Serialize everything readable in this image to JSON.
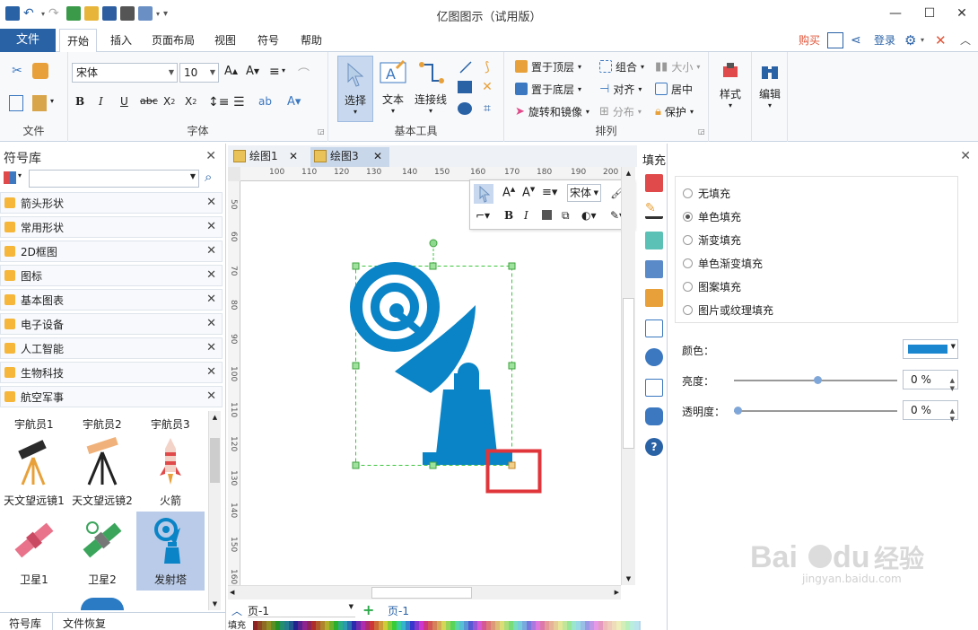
{
  "window": {
    "title": "亿图图示（试用版）",
    "controls": [
      "—",
      "☐",
      "✕"
    ]
  },
  "menu": {
    "file": "文件",
    "tabs": [
      "开始",
      "插入",
      "页面布局",
      "视图",
      "符号",
      "帮助"
    ],
    "active_tab": "开始",
    "right": {
      "buy": "购买",
      "login": "登录"
    }
  },
  "ribbon": {
    "groups": {
      "file": "文件",
      "font": "字体",
      "basic_tools": "基本工具",
      "arrange": "排列"
    },
    "font_name": "宋体",
    "font_size": "10",
    "select_label": "选择",
    "text_label": "文本",
    "connector_label": "连接线",
    "arrange": {
      "bring_front": "置于顶层",
      "send_back": "置于底层",
      "rotate_mirror": "旋转和镜像",
      "group": "组合",
      "align": "对齐",
      "distribute": "分布",
      "size": "大小",
      "center": "居中",
      "protect": "保护"
    },
    "style_label": "样式",
    "edit_label": "编辑"
  },
  "library": {
    "title": "符号库",
    "categories": [
      "箭头形状",
      "常用形状",
      "2D框图",
      "图标",
      "基本图表",
      "电子设备",
      "人工智能",
      "生物科技",
      "航空军事"
    ],
    "symbols_top_labels": [
      "宇航员1",
      "宇航员2",
      "宇航员3"
    ],
    "symbols": [
      {
        "label": "天文望远镜1"
      },
      {
        "label": "天文望远镜2"
      },
      {
        "label": "火箭"
      },
      {
        "label": "卫星1"
      },
      {
        "label": "卫星2"
      },
      {
        "label": "发射塔"
      }
    ],
    "bottom_tabs": [
      "符号库",
      "文件恢复"
    ]
  },
  "documents": {
    "tabs": [
      "绘图1",
      "绘图3"
    ],
    "active": "绘图3"
  },
  "ruler": {
    "h_ticks": [
      "100",
      "110",
      "120",
      "130",
      "140",
      "150",
      "160",
      "170",
      "180",
      "190",
      "200"
    ],
    "v_ticks": [
      "50",
      "60",
      "70",
      "80",
      "90",
      "100",
      "110",
      "120",
      "130",
      "140",
      "150",
      "160"
    ]
  },
  "floatbar": {
    "font": "宋体"
  },
  "pages": {
    "current": "页-1",
    "tab": "页-1",
    "fill_label": "填充"
  },
  "fill": {
    "title": "填充",
    "options": [
      "无填充",
      "单色填充",
      "渐变填充",
      "单色渐变填充",
      "图案填充",
      "图片或纹理填充"
    ],
    "selected": "单色填充",
    "color_label": "颜色：",
    "brightness_label": "亮度：",
    "brightness_value": "0 %",
    "transparency_label": "透明度：",
    "transparency_value": "0 %",
    "brightness_level": 0.5,
    "transparency_level": 0,
    "color": "#1a86d0"
  },
  "colors": {
    "accent": "#2a62a6",
    "shape": "#0a84c6",
    "selection_box": "#e0353a"
  },
  "watermark": {
    "brand": "Baidu经验",
    "url": "jingyan.baidu.com"
  }
}
